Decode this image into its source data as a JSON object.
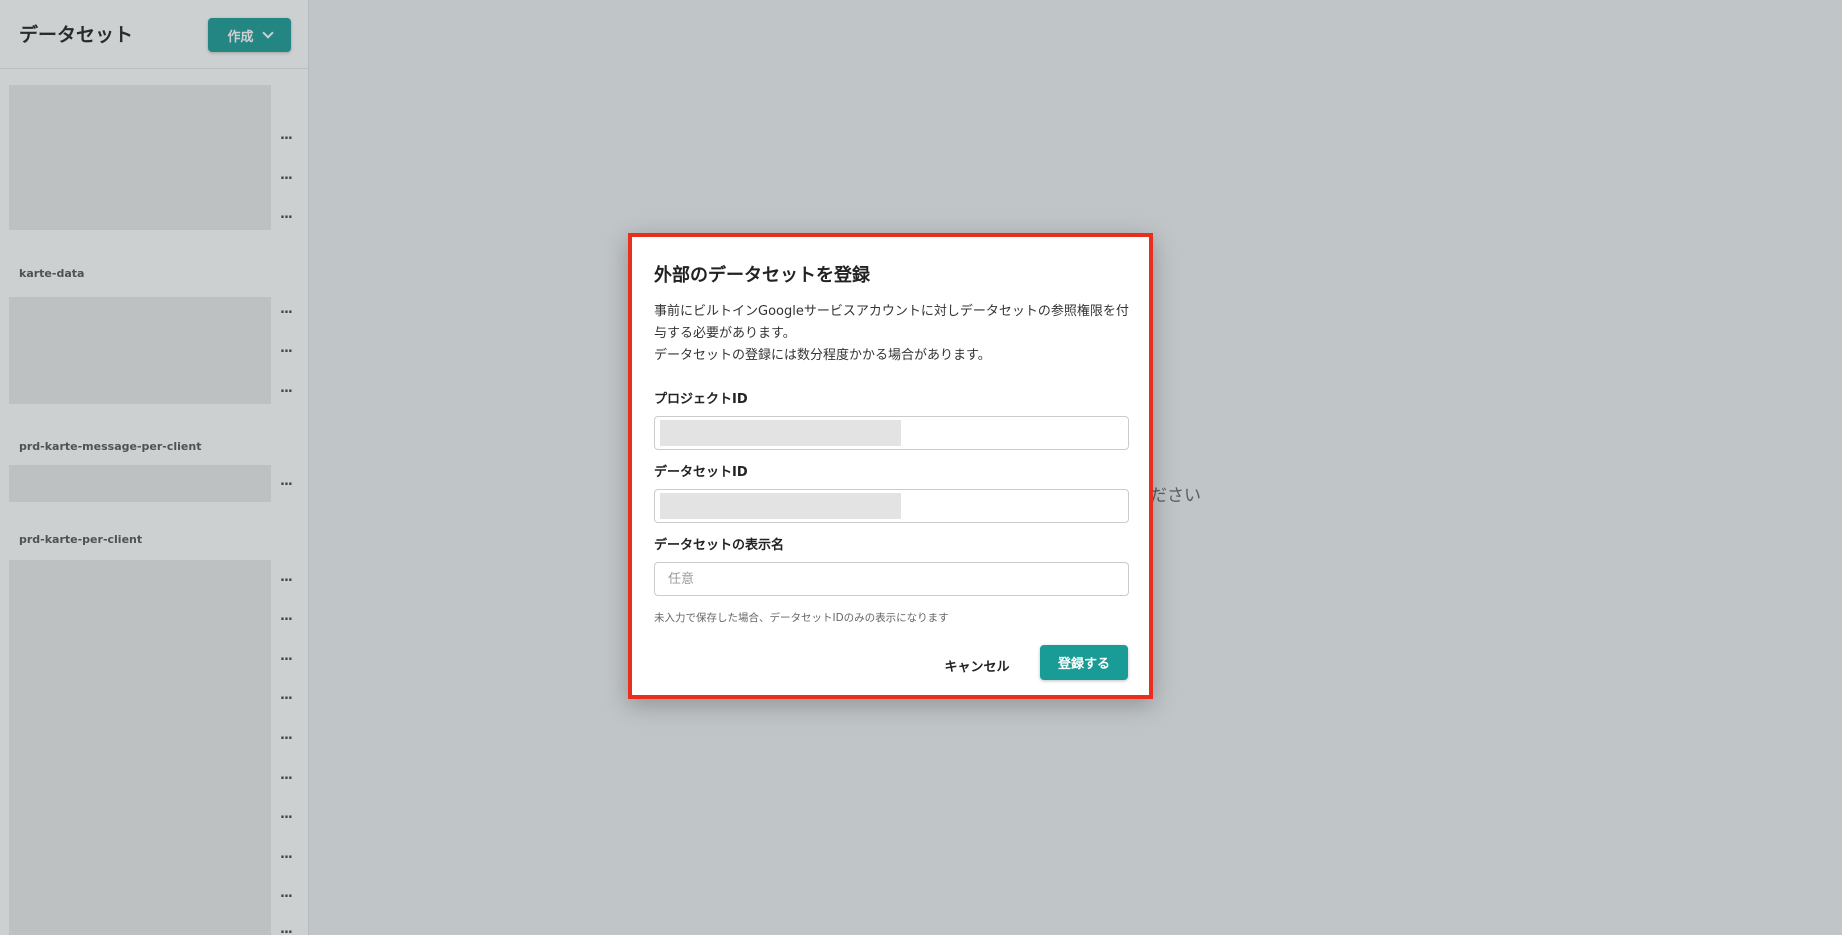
{
  "sidebar": {
    "title": "データセット",
    "create_label": "作成",
    "more_label": "...",
    "groups": [
      {
        "label": "karte-data"
      },
      {
        "label": "prd-karte-message-per-client"
      },
      {
        "label": "prd-karte-per-client"
      }
    ]
  },
  "main": {
    "hint_partial": "ださい"
  },
  "dialog": {
    "title": "外部のデータセットを登録",
    "description_line1": "事前にビルトインGoogleサービスアカウントに対しデータセットの参照権限を付与する必要があります。",
    "description_line2": "データセットの登録には数分程度かかる場合があります。",
    "project_id_label": "プロジェクトID",
    "dataset_id_label": "データセットID",
    "display_name_label": "データセットの表示名",
    "display_name_placeholder": "任意",
    "display_name_hint": "未入力で保存した場合、データセットIDのみの表示になります",
    "cancel_label": "キャンセル",
    "submit_label": "登録する"
  },
  "colors": {
    "accent": "#1a9c96",
    "highlight_border": "#ea2e1d"
  }
}
